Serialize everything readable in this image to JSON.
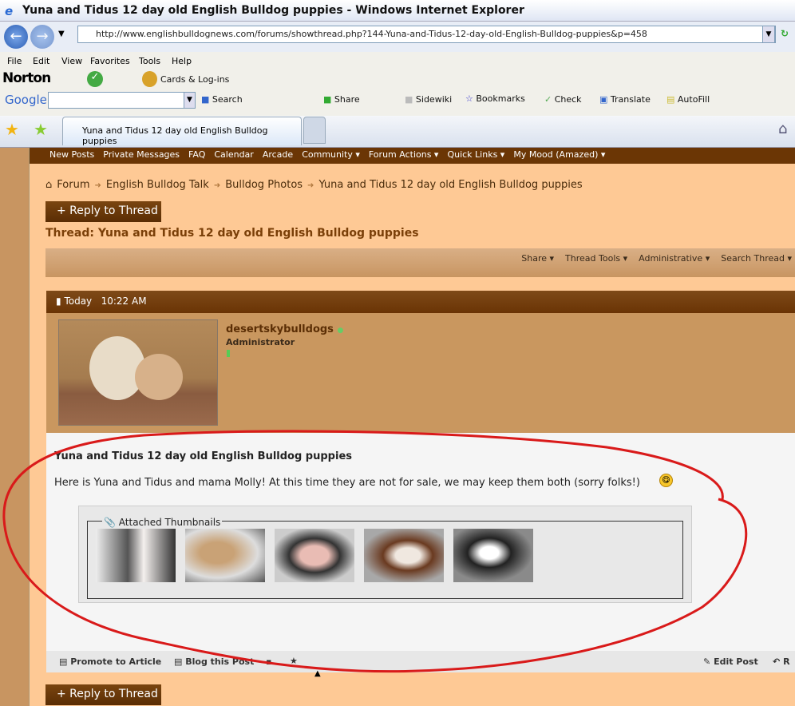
{
  "browser": {
    "window_title": "Yuna and Tidus 12 day old English Bulldog puppies - Windows Internet Explorer",
    "url": "http://www.englishbulldognews.com/forums/showthread.php?144-Yuna-and-Tidus-12-day-old-English-Bulldog-puppies&p=458",
    "menu": [
      "File",
      "Edit",
      "View",
      "Favorites",
      "Tools",
      "Help"
    ],
    "norton": {
      "logo": "Norton",
      "cards": "Cards & Log-ins"
    },
    "google": {
      "logo": "Google",
      "search": "Search",
      "share": "Share",
      "sidewiki": "Sidewiki",
      "bookmarks": "Bookmarks",
      "check": "Check",
      "translate": "Translate",
      "autofill": "AutoFill"
    },
    "tab_title": "Yuna and Tidus 12 day old English Bulldog puppies"
  },
  "forum": {
    "navbar": [
      "New Posts",
      "Private Messages",
      "FAQ",
      "Calendar",
      "Arcade",
      "Community ▾",
      "Forum Actions ▾",
      "Quick Links ▾",
      "My Mood (Amazed) ▾"
    ],
    "breadcrumb": [
      "Forum",
      "English Bulldog Talk",
      "Bulldog Photos",
      "Yuna and Tidus 12 day old English Bulldog puppies"
    ],
    "reply_label": "+ Reply to Thread",
    "thread_title": "Thread: Yuna and Tidus 12 day old English Bulldog puppies",
    "tools": [
      "Share ▾",
      "Thread Tools ▾",
      "Administrative ▾",
      "Search Thread ▾"
    ],
    "post": {
      "date": "Today",
      "time": "10:22 AM",
      "username": "desertskybulldogs",
      "usertitle": "Administrator",
      "title": "Yuna and Tidus 12 day old English Bulldog puppies",
      "body": "Here is Yuna and Tidus and mama Molly! At this time they are not for sale, we may keep them both (sorry folks!)",
      "attachments_label": "Attached Thumbnails",
      "thumbnail_count": 5,
      "footer_left": [
        "Promote to Article",
        "Blog this Post"
      ],
      "footer_right": [
        "Edit Post",
        "R"
      ]
    }
  },
  "colors": {
    "nav": "#6b3605",
    "page": "#fec995",
    "annotation": "#d91a1a"
  }
}
